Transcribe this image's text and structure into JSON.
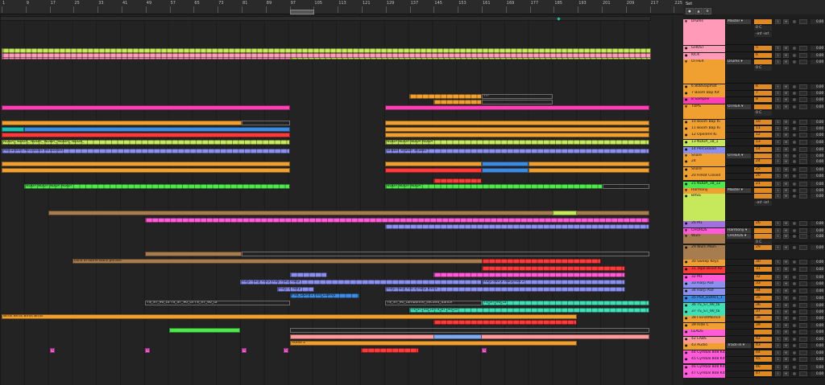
{
  "ruler": {
    "ticks": [
      "1",
      "9",
      "17",
      "25",
      "33",
      "41",
      "49",
      "57",
      "65",
      "73",
      "81",
      "89",
      "97",
      "105",
      "113",
      "121",
      "129",
      "137",
      "145",
      "153",
      "161",
      "169",
      "177",
      "185",
      "193",
      "201",
      "209",
      "217",
      "225"
    ]
  },
  "topbar": {
    "set_label": "Set",
    "btn_a": "●",
    "btn_b": "▲",
    "btn_c": "⚙"
  },
  "colors": {
    "orange": "#f0a030",
    "pink": "#ff3fb4",
    "lime": "#c6e85b",
    "blue": "#3d8be0",
    "periwinkle": "#8b8ff0",
    "violet": "#a070e0",
    "brown": "#a77c4e",
    "green": "#4ee84e",
    "mint": "#3fe0b5",
    "red": "#ff3a3a",
    "magenta": "#ff5ad8",
    "salmon": "#ff9a9a",
    "teal": "#20d0c0"
  },
  "tracks": [
    {
      "name": "Drums",
      "color": "#ff9ab8",
      "routing": "Master",
      "num": "",
      "group": true,
      "sub1": "0",
      "sub2": "-inf   -inf",
      "db": "0.00"
    },
    {
      "name": "GHOST",
      "color": "#ff9ab8",
      "routing": "",
      "num": "5",
      "db": "0.00"
    },
    {
      "name": "KICK",
      "color": "#ff9ab8",
      "routing": "",
      "num": "6",
      "db": "0.00"
    },
    {
      "name": "OTHER",
      "color": "#f0a030",
      "routing": "Drums",
      "num": "",
      "group": true,
      "sub1": "0",
      "db": "0.00"
    },
    {
      "name": "6 808Slapmat",
      "color": "#f0a030",
      "routing": "",
      "num": "6",
      "db": "0.00"
    },
    {
      "name": "7 Boom Bap Kit",
      "color": "#f0a030",
      "routing": "",
      "num": "7",
      "db": "0.00"
    },
    {
      "name": "8 Sampler",
      "color": "#ff3fb4",
      "routing": "",
      "num": "8",
      "db": "0.00"
    },
    {
      "name": "TOPS",
      "color": "#f0a030",
      "routing": "OTHER",
      "num": "",
      "group": true,
      "sub1": "0",
      "db": "0.00"
    },
    {
      "name": "10 Boom Bap Ki",
      "color": "#f0a030",
      "routing": "",
      "num": "10",
      "db": "0.00"
    },
    {
      "name": "11 Boom Bap Ki",
      "color": "#f0a030",
      "routing": "",
      "num": "11",
      "db": "0.00"
    },
    {
      "name": "12 OpenHH Ki",
      "color": "#f0a030",
      "routing": "",
      "num": "12",
      "db": "0.00"
    },
    {
      "name": "13 NDDA_18_1",
      "color": "#c6e85b",
      "routing": "",
      "num": "13",
      "db": "0.00"
    },
    {
      "name": "14 Percussion",
      "color": "#8b8ff0",
      "routing": "",
      "num": "14",
      "db": "0.00"
    },
    {
      "name": "Snare",
      "color": "#f0a030",
      "routing": "OTHER",
      "num": "",
      "group": true,
      "sub1": "-2.0",
      "db": "0.00"
    },
    {
      "name": "24",
      "color": "#f0a030",
      "routing": "",
      "num": "24",
      "db": "0.00"
    },
    {
      "name": "Snare",
      "color": "#f0a030",
      "routing": "",
      "num": "25",
      "db": "0.00"
    },
    {
      "name": "20 HiHat Closed",
      "color": "#f0a030",
      "routing": "",
      "num": "20",
      "db": "0.00"
    },
    {
      "name": "21 NDDA_18_12",
      "color": "#4ee84e",
      "routing": "",
      "num": "21",
      "db": "0.00"
    },
    {
      "name": "Harmony",
      "color": "#f0a030",
      "routing": "Master",
      "num": "",
      "group": true,
      "sub1": "0",
      "sub2": "-inf   -inf",
      "db": "0.00"
    },
    {
      "name": "BASS",
      "color": "#c6e85b",
      "routing": "",
      "num": "",
      "db": "0.00"
    },
    {
      "name": "26 M1",
      "color": "#a070e0",
      "routing": "",
      "num": "26",
      "db": "0.00"
    },
    {
      "name": "CHORDS",
      "color": "#ff5ad8",
      "routing": "Harmony",
      "num": "",
      "group": true,
      "sub1": "0",
      "db": "0.00"
    },
    {
      "name": "Wurli",
      "color": "#a77c4e",
      "routing": "CHORDS",
      "num": "",
      "group": true,
      "sub1": "0",
      "db": "0.00"
    },
    {
      "name": "29 Wurli Main",
      "color": "#a77c4e",
      "routing": "",
      "num": "29",
      "db": "0.00"
    },
    {
      "name": "30 Sweep Keys",
      "color": "#f0a030",
      "routing": "",
      "num": "30",
      "db": "0.00"
    },
    {
      "name": "31 Tape Beast Ke",
      "color": "#ff3a3a",
      "routing": "",
      "num": "31",
      "db": "0.00"
    },
    {
      "name": "32 M1",
      "color": "#ff5ad8",
      "routing": "",
      "num": "32",
      "db": "0.00"
    },
    {
      "name": "33 Harp Pad",
      "color": "#8b8ff0",
      "routing": "",
      "num": "33",
      "db": "0.00"
    },
    {
      "name": "34 Harp Pad",
      "color": "#8b8ff0",
      "routing": "",
      "num": "34",
      "db": "0.00"
    },
    {
      "name": "35 PSX_DDRV1_1",
      "color": "#3d8be0",
      "routing": "",
      "num": "35",
      "db": "0.00"
    },
    {
      "name": "36 TS_ST_90_ta",
      "color": "#3fe0b5",
      "routing": "",
      "num": "36",
      "db": "0.00"
    },
    {
      "name": "37 TS_ST_90_ta",
      "color": "#3fe0b5",
      "routing": "",
      "num": "37",
      "db": "0.00"
    },
    {
      "name": "38 FloristMornin",
      "color": "#f0a030",
      "routing": "",
      "num": "38",
      "db": "0.00"
    },
    {
      "name": "39 Ride C",
      "color": "#f0a030",
      "routing": "",
      "num": "39",
      "db": "0.00"
    },
    {
      "name": "LEADS",
      "color": "#ff5ad8",
      "routing": "",
      "num": "",
      "db": "0.00"
    },
    {
      "name": "42 LABS",
      "color": "#ff9a9a",
      "routing": "",
      "num": "42",
      "db": "0.00"
    },
    {
      "name": "43 Audio",
      "color": "#f0a030",
      "routing": "Track-in",
      "num": "43",
      "db": "0.00"
    },
    {
      "name": "44 Cymbal 808 Kit",
      "color": "#ff5ad8",
      "routing": "",
      "num": "44",
      "db": "0.00"
    },
    {
      "name": "45 Cymbal 808 Kit",
      "color": "#ff5ad8",
      "routing": "",
      "num": "45",
      "db": "0.00"
    },
    {
      "name": "46 Cymbal 808 Kit",
      "color": "#ff5ad8",
      "routing": "",
      "num": "46",
      "db": "0.00"
    },
    {
      "name": "47 Cymbal 808 Kit",
      "color": "#ff5ad8",
      "routing": "",
      "num": "47",
      "db": "0.00"
    }
  ],
  "clips": [
    {
      "lane": 0,
      "start": 0,
      "end": 808,
      "color": "#2c2c2c",
      "label": ""
    },
    {
      "lane": 1,
      "start": 2,
      "end": 808,
      "color": "#c6e85b",
      "label": "",
      "pattern": "stripes"
    },
    {
      "lane": 2,
      "start": 2,
      "end": 808,
      "color": "#ff9ab8",
      "label": "",
      "pattern": "stripes"
    },
    {
      "lane": 2,
      "start": 360,
      "end": 808,
      "color": "#c6e85b",
      "label": "",
      "pattern": "stripes"
    },
    {
      "lane": 5,
      "start": 508,
      "end": 598,
      "color": "#f0a030",
      "label": "",
      "pattern": "seg"
    },
    {
      "lane": 5,
      "start": 598,
      "end": 686,
      "color": "#2a2a2a",
      "label": "???",
      "pattern": "empty"
    },
    {
      "lane": 6,
      "start": 538,
      "end": 598,
      "color": "#f0a030",
      "label": "",
      "pattern": "seg"
    },
    {
      "lane": 6,
      "start": 598,
      "end": 686,
      "color": "#2a2a2a",
      "label": "",
      "pattern": "empty"
    },
    {
      "lane": 7,
      "start": 2,
      "end": 360,
      "color": "#ff3fb4",
      "label": ""
    },
    {
      "lane": 7,
      "start": 478,
      "end": 806,
      "color": "#ff3fb4",
      "label": ""
    },
    {
      "lane": 9,
      "start": 2,
      "end": 300,
      "color": "#f0a030",
      "label": ""
    },
    {
      "lane": 9,
      "start": 300,
      "end": 360,
      "color": "#2a2a2a",
      "label": "",
      "pattern": "empty"
    },
    {
      "lane": 9,
      "start": 478,
      "end": 806,
      "color": "#f0a030",
      "label": ""
    },
    {
      "lane": 10,
      "start": 2,
      "end": 30,
      "color": "#20c0b0",
      "label": ""
    },
    {
      "lane": 10,
      "start": 30,
      "end": 360,
      "color": "#3d8be0",
      "label": ""
    },
    {
      "lane": 10,
      "start": 478,
      "end": 806,
      "color": "#f0a030",
      "label": ""
    },
    {
      "lane": 11,
      "start": 2,
      "end": 360,
      "color": "#ff3a3a",
      "label": ""
    },
    {
      "lane": 11,
      "start": 478,
      "end": 806,
      "color": "#f0a030",
      "label": ""
    },
    {
      "lane": 12,
      "start": 2,
      "end": 360,
      "color": "#c6e85b",
      "label": "NDDA_ NDDA_ NDDA_ NDDA_ NDDA_ NDDA_",
      "pattern": "seg"
    },
    {
      "lane": 12,
      "start": 478,
      "end": 806,
      "color": "#c6e85b",
      "label": "NDDA NDDA NDDA NDDA",
      "pattern": "seg"
    },
    {
      "lane": 13,
      "start": 2,
      "end": 360,
      "color": "#8b8ff0",
      "label": "Percussion Percussion Percussion",
      "pattern": "seg"
    },
    {
      "lane": 13,
      "start": 478,
      "end": 806,
      "color": "#8b8ff0",
      "label": "Shaker Shaker Shaker",
      "pattern": "seg"
    },
    {
      "lane": 15,
      "start": 2,
      "end": 360,
      "color": "#f0a030",
      "label": ""
    },
    {
      "lane": 15,
      "start": 478,
      "end": 598,
      "color": "#f0a030",
      "label": ""
    },
    {
      "lane": 15,
      "start": 598,
      "end": 656,
      "color": "#3d8be0",
      "label": ""
    },
    {
      "lane": 15,
      "start": 656,
      "end": 806,
      "color": "#f0a030",
      "label": ""
    },
    {
      "lane": 16,
      "start": 2,
      "end": 360,
      "color": "#f0a030",
      "label": ""
    },
    {
      "lane": 16,
      "start": 478,
      "end": 598,
      "color": "#ff3a3a",
      "label": ""
    },
    {
      "lane": 16,
      "start": 598,
      "end": 656,
      "color": "#3d8be0",
      "label": ""
    },
    {
      "lane": 16,
      "start": 656,
      "end": 806,
      "color": "#f0a030",
      "label": ""
    },
    {
      "lane": 17,
      "start": 538,
      "end": 598,
      "color": "#ff3a3a",
      "label": "",
      "pattern": "seg"
    },
    {
      "lane": 18,
      "start": 30,
      "end": 360,
      "color": "#4ee84e",
      "label": "NDDA NDDA NDDA NDDA",
      "pattern": "seg"
    },
    {
      "lane": 18,
      "start": 478,
      "end": 748,
      "color": "#4ee84e",
      "label": "NDDA NDDA NDDA",
      "pattern": "seg"
    },
    {
      "lane": 18,
      "start": 748,
      "end": 806,
      "color": "#2a2a2a",
      "label": "",
      "pattern": "empty"
    },
    {
      "lane": 21,
      "start": 60,
      "end": 806,
      "color": "#a77c4e",
      "label": ""
    },
    {
      "lane": 21,
      "start": 686,
      "end": 716,
      "color": "#c6e85b",
      "label": ""
    },
    {
      "lane": 22,
      "start": 180,
      "end": 806,
      "color": "#ff5ad8",
      "label": "",
      "pattern": "seg"
    },
    {
      "lane": 23,
      "start": 478,
      "end": 806,
      "color": "#8b8ff0",
      "label": "",
      "pattern": "seg"
    },
    {
      "lane": 26,
      "start": 180,
      "end": 300,
      "color": "#a77c4e",
      "label": ""
    },
    {
      "lane": 26,
      "start": 300,
      "end": 806,
      "color": "#2a2a2a",
      "label": "",
      "pattern": "empty"
    },
    {
      "lane": 27,
      "start": 90,
      "end": 746,
      "color": "#a77c4e",
      "label": "Lock of some Back phrase"
    },
    {
      "lane": 27,
      "start": 598,
      "end": 746,
      "color": "#ff3a3a",
      "label": "",
      "pattern": "seg"
    },
    {
      "lane": 28,
      "start": 598,
      "end": 776,
      "color": "#ff3a3a",
      "label": "",
      "pattern": "seg"
    },
    {
      "lane": 29,
      "start": 360,
      "end": 406,
      "color": "#8b8ff0",
      "label": "",
      "pattern": "seg"
    },
    {
      "lane": 29,
      "start": 538,
      "end": 776,
      "color": "#ff5ad8",
      "label": "",
      "pattern": "seg"
    },
    {
      "lane": 30,
      "start": 298,
      "end": 598,
      "color": "#8b8ff0",
      "label": "Harp Harp Harp Harp Harp Harp",
      "pattern": "seg"
    },
    {
      "lane": 30,
      "start": 598,
      "end": 776,
      "color": "#8b8ff0",
      "label": "Harp Pad 2 Harp Pad 2",
      "pattern": "seg"
    },
    {
      "lane": 31,
      "start": 344,
      "end": 390,
      "color": "#8b8ff0",
      "label": "Harp 2 Harp",
      "pattern": "seg"
    },
    {
      "lane": 31,
      "start": 478,
      "end": 776,
      "color": "#8b8ff0",
      "label": "Harp Harp Pad 2 Harp Pad 2",
      "pattern": "seg"
    },
    {
      "lane": 32,
      "start": 360,
      "end": 446,
      "color": "#3d8be0",
      "label": "PSX_DDRV1 PSX_DDRV1",
      "pattern": "seg"
    },
    {
      "lane": 33,
      "start": 180,
      "end": 360,
      "color": "#3a3a3a",
      "label": "TS_ST_90_ta TS_ST_90_ta TS_ST_90_ta",
      "pattern": "empty"
    },
    {
      "lane": 33,
      "start": 478,
      "end": 598,
      "color": "#3a3a3a",
      "label": "TS_ST_90_tamborine_second_dance",
      "pattern": "empty"
    },
    {
      "lane": 33,
      "start": 598,
      "end": 806,
      "color": "#3fe0b5",
      "label": "TS_ST_90_ta",
      "pattern": "seg"
    },
    {
      "lane": 34,
      "start": 508,
      "end": 806,
      "color": "#3fe0b5",
      "label": "TS_ST_90_ta TS_ST_90_ta",
      "pattern": "seg"
    },
    {
      "lane": 35,
      "start": 2,
      "end": 716,
      "color": "#f0a030",
      "label": "Birds          Birds          Birds          Birds"
    },
    {
      "lane": 36,
      "start": 538,
      "end": 716,
      "color": "#ff3a3a",
      "label": "",
      "pattern": "seg"
    },
    {
      "lane": 37,
      "start": 210,
      "end": 298,
      "color": "#4ee84e",
      "label": ""
    },
    {
      "lane": 37,
      "start": 360,
      "end": 806,
      "color": "#2a2a2a",
      "label": "",
      "pattern": "empty"
    },
    {
      "lane": 38,
      "start": 360,
      "end": 806,
      "color": "#ff9a9a",
      "label": ""
    },
    {
      "lane": 38,
      "start": 538,
      "end": 598,
      "color": "#7faaf0",
      "label": ""
    },
    {
      "lane": 39,
      "start": 360,
      "end": 716,
      "color": "#f0a030",
      "label": "Audio 2"
    },
    {
      "lane": 40,
      "start": 62,
      "end": 68,
      "color": "#ff5ad8",
      "label": "Cy"
    },
    {
      "lane": 40,
      "start": 180,
      "end": 186,
      "color": "#ff5ad8",
      "label": "Cy"
    },
    {
      "lane": 40,
      "start": 300,
      "end": 306,
      "color": "#ff5ad8",
      "label": "Cy"
    },
    {
      "lane": 40,
      "start": 352,
      "end": 358,
      "color": "#ff5ad8",
      "label": "Cy"
    },
    {
      "lane": 40,
      "start": 448,
      "end": 520,
      "color": "#ff3a3a",
      "label": "",
      "pattern": "seg"
    },
    {
      "lane": 40,
      "start": 598,
      "end": 604,
      "color": "#ff5ad8",
      "label": "Cy"
    }
  ]
}
